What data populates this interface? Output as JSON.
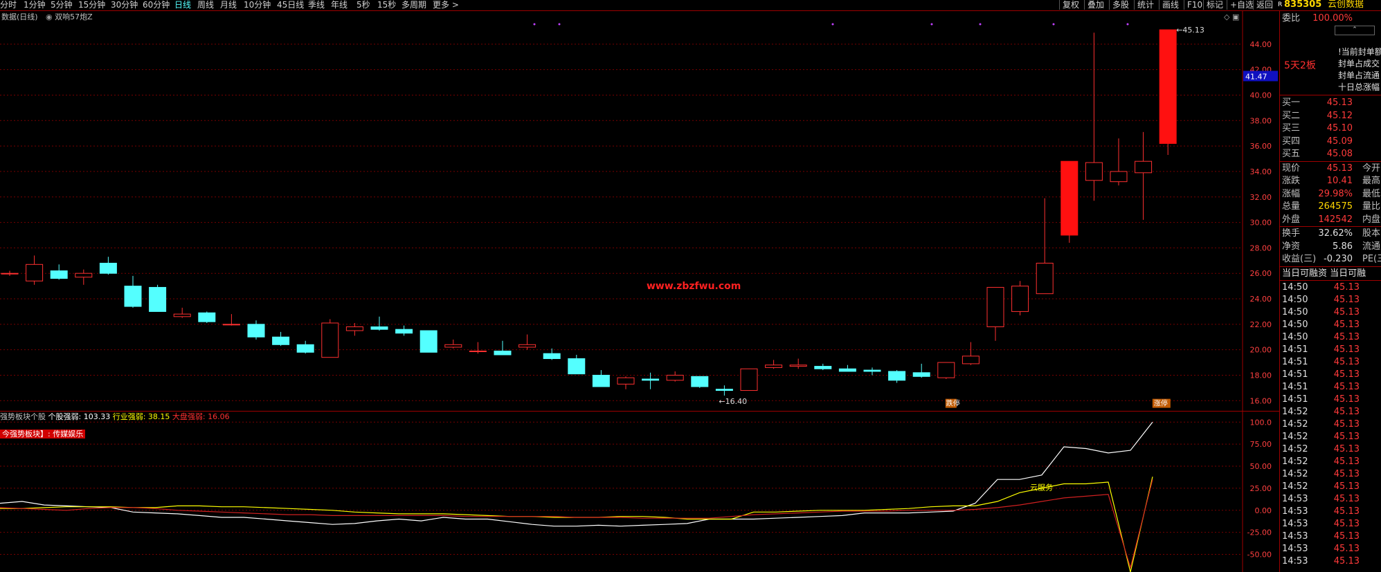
{
  "periods": [
    "分时",
    "1分钟",
    "5分钟",
    "15分钟",
    "30分钟",
    "60分钟",
    "日线",
    "周线",
    "月线",
    "10分钟",
    "45日线",
    "季线",
    "年线",
    "5秒",
    "15秒",
    "多周期",
    "更多 >"
  ],
  "active_period": "日线",
  "tools": [
    "复权",
    "叠加",
    "多股",
    "统计",
    "画线",
    "F10",
    "标记",
    "+自选",
    "返回"
  ],
  "stock": {
    "code": "835305",
    "name": "云创数据"
  },
  "chart_titles": {
    "main": "数据(日线)",
    "indicator": "双响57炮Z",
    "sub": "强势板块个股",
    "sub_metric": "个股强弱: 103.33",
    "industry": "行业强弱: 38.15",
    "market": "大盘强弱: 16.06",
    "sector_tag": "今强势板块】: 传媒娱乐"
  },
  "watermark": "www.zbzfwu.com",
  "price_axis": [
    "44.00",
    "42.00",
    "40.00",
    "38.00",
    "36.00",
    "34.00",
    "32.00",
    "30.00",
    "28.00",
    "26.00",
    "24.00",
    "22.00",
    "20.00",
    "18.00",
    "16.00"
  ],
  "price_marker": "41.47",
  "osc_axis": [
    "100.0",
    "75.00",
    "50.00",
    "25.00",
    "0.00",
    "-25.00",
    "-50.00"
  ],
  "annotations": {
    "high": "45.13",
    "low": "16.40",
    "tag1": "涨停",
    "tag2": "跌停",
    "line_label": "云服务"
  },
  "chart_data": [
    {
      "type": "candlestick",
      "ylim": [
        15.2,
        46.6
      ],
      "candles": [
        {
          "o": 26.0,
          "h": 26.2,
          "l": 25.8,
          "c": 26.0
        },
        {
          "o": 25.4,
          "h": 27.4,
          "l": 25.1,
          "c": 26.7
        },
        {
          "o": 26.2,
          "h": 26.7,
          "l": 25.5,
          "c": 25.6
        },
        {
          "o": 25.7,
          "h": 26.3,
          "l": 25.1,
          "c": 26.0
        },
        {
          "o": 26.8,
          "h": 27.3,
          "l": 25.9,
          "c": 26.0
        },
        {
          "o": 25.0,
          "h": 25.8,
          "l": 23.3,
          "c": 23.4
        },
        {
          "o": 24.9,
          "h": 25.1,
          "l": 23.0,
          "c": 23.0
        },
        {
          "o": 22.6,
          "h": 23.3,
          "l": 22.5,
          "c": 22.8
        },
        {
          "o": 22.9,
          "h": 23.0,
          "l": 22.1,
          "c": 22.2
        },
        {
          "o": 22.0,
          "h": 22.8,
          "l": 21.9,
          "c": 22.0
        },
        {
          "o": 22.0,
          "h": 22.3,
          "l": 20.8,
          "c": 21.0
        },
        {
          "o": 21.0,
          "h": 21.4,
          "l": 20.3,
          "c": 20.4
        },
        {
          "o": 20.4,
          "h": 20.7,
          "l": 19.7,
          "c": 19.8
        },
        {
          "o": 19.4,
          "h": 22.4,
          "l": 19.4,
          "c": 22.1
        },
        {
          "o": 21.5,
          "h": 22.1,
          "l": 21.1,
          "c": 21.8
        },
        {
          "o": 21.8,
          "h": 22.6,
          "l": 21.5,
          "c": 21.6
        },
        {
          "o": 21.6,
          "h": 21.9,
          "l": 21.1,
          "c": 21.3
        },
        {
          "o": 21.5,
          "h": 21.5,
          "l": 19.8,
          "c": 19.8
        },
        {
          "o": 20.2,
          "h": 20.8,
          "l": 20.1,
          "c": 20.4
        },
        {
          "o": 19.9,
          "h": 20.6,
          "l": 19.7,
          "c": 19.9
        },
        {
          "o": 19.9,
          "h": 20.7,
          "l": 19.6,
          "c": 19.6
        },
        {
          "o": 20.2,
          "h": 21.2,
          "l": 20.0,
          "c": 20.4
        },
        {
          "o": 19.7,
          "h": 20.1,
          "l": 19.2,
          "c": 19.3
        },
        {
          "o": 19.3,
          "h": 19.6,
          "l": 18.1,
          "c": 18.1
        },
        {
          "o": 18.0,
          "h": 18.4,
          "l": 17.1,
          "c": 17.1
        },
        {
          "o": 17.3,
          "h": 17.9,
          "l": 16.9,
          "c": 17.8
        },
        {
          "o": 17.7,
          "h": 18.2,
          "l": 16.9,
          "c": 17.6
        },
        {
          "o": 17.6,
          "h": 18.3,
          "l": 17.5,
          "c": 18.0
        },
        {
          "o": 17.9,
          "h": 17.9,
          "l": 17.0,
          "c": 17.1
        },
        {
          "o": 16.9,
          "h": 17.2,
          "l": 16.4,
          "c": 16.8
        },
        {
          "o": 16.8,
          "h": 18.5,
          "l": 16.8,
          "c": 18.5
        },
        {
          "o": 18.6,
          "h": 19.2,
          "l": 18.5,
          "c": 18.8
        },
        {
          "o": 18.7,
          "h": 19.3,
          "l": 18.5,
          "c": 18.8
        },
        {
          "o": 18.7,
          "h": 18.9,
          "l": 18.4,
          "c": 18.5
        },
        {
          "o": 18.5,
          "h": 18.8,
          "l": 18.3,
          "c": 18.3
        },
        {
          "o": 18.4,
          "h": 18.6,
          "l": 18.0,
          "c": 18.3
        },
        {
          "o": 18.3,
          "h": 18.4,
          "l": 17.4,
          "c": 17.6
        },
        {
          "o": 18.2,
          "h": 18.9,
          "l": 17.8,
          "c": 17.9
        },
        {
          "o": 17.8,
          "h": 19.0,
          "l": 17.7,
          "c": 19.0
        },
        {
          "o": 18.9,
          "h": 20.6,
          "l": 18.8,
          "c": 19.5
        },
        {
          "o": 21.8,
          "h": 24.9,
          "l": 20.7,
          "c": 24.9
        },
        {
          "o": 23.0,
          "h": 25.4,
          "l": 22.7,
          "c": 25.0
        },
        {
          "o": 24.4,
          "h": 31.9,
          "l": 24.4,
          "c": 26.8
        },
        {
          "o": 29.0,
          "h": 34.8,
          "l": 28.4,
          "c": 34.8
        },
        {
          "o": 33.3,
          "h": 44.9,
          "l": 31.7,
          "c": 34.7
        },
        {
          "o": 33.2,
          "h": 36.6,
          "l": 32.9,
          "c": 34.0
        },
        {
          "o": 33.9,
          "h": 37.1,
          "l": 30.2,
          "c": 34.8
        },
        {
          "o": 36.2,
          "h": 45.13,
          "l": 35.3,
          "c": 45.13
        }
      ]
    },
    {
      "type": "line",
      "ylim": [
        -70,
        112
      ],
      "series": [
        {
          "name": "个股强弱",
          "color": "#ffffff",
          "values": [
            8,
            10,
            6,
            5,
            4,
            3,
            -2,
            -3,
            -4,
            -6,
            -8,
            -8,
            -10,
            -12,
            -14,
            -16,
            -15,
            -12,
            -10,
            -12,
            -8,
            -10,
            -10,
            -13,
            -16,
            -18,
            -18,
            -17,
            -18,
            -17,
            -16,
            -15,
            -10,
            -10,
            -10,
            -9,
            -8,
            -7,
            -6,
            -3,
            -3,
            -3,
            -2,
            -1,
            8,
            35,
            35,
            40,
            72,
            70,
            65,
            68,
            100
          ]
        },
        {
          "name": "行业强弱",
          "color": "#ffff00",
          "values": [
            2,
            2,
            3,
            4,
            4,
            4,
            3,
            3,
            5,
            5,
            4,
            4,
            3,
            2,
            1,
            0,
            -2,
            -3,
            -4,
            -4,
            -4,
            -5,
            -6,
            -7,
            -7,
            -8,
            -8,
            -8,
            -7,
            -7,
            -8,
            -10,
            -10,
            -10,
            -2,
            -2,
            -1,
            0,
            0,
            0,
            1,
            2,
            4,
            5,
            5,
            10,
            20,
            25,
            30,
            30,
            32,
            -70,
            38
          ]
        },
        {
          "name": "大盘强弱",
          "color": "#d02020",
          "values": [
            3,
            2,
            1,
            0,
            2,
            3,
            3,
            2,
            0,
            -1,
            -2,
            -3,
            -4,
            -5,
            -5,
            -6,
            -6,
            -6,
            -6,
            -6,
            -6,
            -7,
            -7,
            -7,
            -7,
            -7,
            -8,
            -8,
            -8,
            -9,
            -9,
            -9,
            -9,
            -7,
            -5,
            -4,
            -3,
            -2,
            -1,
            -1,
            -1,
            0,
            0,
            0,
            1,
            3,
            6,
            10,
            14,
            16,
            18,
            -65,
            35
          ]
        }
      ]
    }
  ],
  "panel": {
    "top": [
      {
        "label": "委比",
        "value": "100.00%"
      }
    ],
    "board_label": "5天2板",
    "board_lines": [
      "!当前封单额",
      "封单占成交",
      "封单占流通",
      "十日总涨幅"
    ],
    "bids": [
      {
        "label": "买一",
        "value": "45.13"
      },
      {
        "label": "买二",
        "value": "45.12"
      },
      {
        "label": "买三",
        "value": "45.10"
      },
      {
        "label": "买四",
        "value": "45.09"
      },
      {
        "label": "买五",
        "value": "45.08"
      }
    ],
    "quote": [
      {
        "label": "现价",
        "value": "45.13",
        "extra": "今开"
      },
      {
        "label": "涨跌",
        "value": "10.41",
        "extra": "最高"
      },
      {
        "label": "涨幅",
        "value": "29.98%",
        "extra": "最低"
      },
      {
        "label": "总量",
        "value": "264575",
        "extra": "量比"
      },
      {
        "label": "外盘",
        "value": "142542",
        "extra": "内盘"
      }
    ],
    "stats": [
      {
        "label": "换手",
        "value": "32.62%",
        "extra": "股本"
      },
      {
        "label": "净资",
        "value": "5.86",
        "extra": "流通"
      },
      {
        "label": "收益(三)",
        "value": "-0.230",
        "extra": "PE(三)"
      }
    ],
    "margin_header": "当日可融资 当日可融",
    "trades": [
      {
        "t": "14:50",
        "p": "45.13"
      },
      {
        "t": "14:50",
        "p": "45.13"
      },
      {
        "t": "14:50",
        "p": "45.13"
      },
      {
        "t": "14:50",
        "p": "45.13"
      },
      {
        "t": "14:50",
        "p": "45.13"
      },
      {
        "t": "14:51",
        "p": "45.13"
      },
      {
        "t": "14:51",
        "p": "45.13"
      },
      {
        "t": "14:51",
        "p": "45.13"
      },
      {
        "t": "14:51",
        "p": "45.13"
      },
      {
        "t": "14:51",
        "p": "45.13"
      },
      {
        "t": "14:52",
        "p": "45.13"
      },
      {
        "t": "14:52",
        "p": "45.13"
      },
      {
        "t": "14:52",
        "p": "45.13"
      },
      {
        "t": "14:52",
        "p": "45.13"
      },
      {
        "t": "14:52",
        "p": "45.13"
      },
      {
        "t": "14:52",
        "p": "45.13"
      },
      {
        "t": "14:52",
        "p": "45.13"
      },
      {
        "t": "14:53",
        "p": "45.13"
      },
      {
        "t": "14:53",
        "p": "45.13"
      },
      {
        "t": "14:53",
        "p": "45.13"
      },
      {
        "t": "14:53",
        "p": "45.13"
      },
      {
        "t": "14:53",
        "p": "45.13"
      },
      {
        "t": "14:53",
        "p": "45.13"
      }
    ]
  }
}
